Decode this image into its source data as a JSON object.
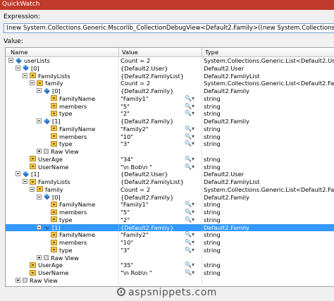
{
  "window": {
    "title": "QuickWatch"
  },
  "expression": {
    "label": "Expression:",
    "value": "(new System.Collections.Generic.Mscorlib_CollectionDebugView<Default2.Family>((new System.Collections.Generic.Mscorlib_CollectionDebugView<Default2"
  },
  "value_label": "Value:",
  "grid": {
    "columns": [
      "Name",
      "Value",
      "Type"
    ],
    "rows": [
      {
        "indent": 0,
        "toggle": "minus",
        "icon": "field-icon",
        "name": "userLists",
        "value": "Count = 2",
        "type": "System.Collections.Generic.List<Default2.User>",
        "mag": false
      },
      {
        "indent": 1,
        "toggle": "minus",
        "icon": "field-icon",
        "name": "[0]",
        "value": "{Default2.User}",
        "type": "Default2.User",
        "mag": false
      },
      {
        "indent": 2,
        "toggle": "minus",
        "icon": "property-icon",
        "name": "FamilyLists",
        "value": "{Default2.FamilyList}",
        "type": "Default2.FamilyList",
        "mag": false
      },
      {
        "indent": 3,
        "toggle": "minus",
        "icon": "property-icon",
        "name": "family",
        "value": "Count = 2",
        "type": "System.Collections.Generic.List<Default2.Family>",
        "mag": false
      },
      {
        "indent": 4,
        "toggle": "minus",
        "icon": "field-icon",
        "name": "[0]",
        "value": "{Default2.Family}",
        "type": "Default2.Family",
        "mag": false
      },
      {
        "indent": 5,
        "toggle": "none",
        "icon": "property-icon",
        "name": "FamilyName",
        "value": "\"Family1\"",
        "type": "string",
        "mag": true
      },
      {
        "indent": 5,
        "toggle": "none",
        "icon": "property-icon",
        "name": "members",
        "value": "\"5\"",
        "type": "string",
        "mag": true
      },
      {
        "indent": 5,
        "toggle": "none",
        "icon": "property-icon",
        "name": "type",
        "value": "\"2\"",
        "type": "string",
        "mag": true
      },
      {
        "indent": 4,
        "toggle": "minus",
        "icon": "field-icon",
        "name": "[1]",
        "value": "{Default2.Family}",
        "type": "Default2.Family",
        "mag": false
      },
      {
        "indent": 5,
        "toggle": "none",
        "icon": "property-icon",
        "name": "FamilyName",
        "value": "\"Family2\"",
        "type": "string",
        "mag": true
      },
      {
        "indent": 5,
        "toggle": "none",
        "icon": "property-icon",
        "name": "members",
        "value": "\"10\"",
        "type": "string",
        "mag": true
      },
      {
        "indent": 5,
        "toggle": "none",
        "icon": "property-icon",
        "name": "type",
        "value": "\"3\"",
        "type": "string",
        "mag": true
      },
      {
        "indent": 4,
        "toggle": "plus",
        "icon": "raw-view-icon",
        "name": "Raw View",
        "value": "",
        "type": "",
        "mag": false
      },
      {
        "indent": 2,
        "toggle": "none",
        "icon": "property-icon",
        "name": "UserAge",
        "value": "\"34\"",
        "type": "string",
        "mag": true
      },
      {
        "indent": 2,
        "toggle": "none",
        "icon": "property-icon",
        "name": "UserName",
        "value": "\"\\n      Bob\\n      \"",
        "type": "string",
        "mag": true
      },
      {
        "indent": 1,
        "toggle": "minus",
        "icon": "field-icon",
        "name": "[1]",
        "value": "{Default2.User}",
        "type": "Default2.User",
        "mag": false
      },
      {
        "indent": 2,
        "toggle": "minus",
        "icon": "property-icon",
        "name": "FamilyLists",
        "value": "{Default2.FamilyList}",
        "type": "Default2.FamilyList",
        "mag": false
      },
      {
        "indent": 3,
        "toggle": "minus",
        "icon": "property-icon",
        "name": "family",
        "value": "Count = 2",
        "type": "System.Collections.Generic.List<Default2.Family>",
        "mag": false
      },
      {
        "indent": 4,
        "toggle": "minus",
        "icon": "field-icon",
        "name": "[0]",
        "value": "{Default2.Family}",
        "type": "Default2.Family",
        "mag": false
      },
      {
        "indent": 5,
        "toggle": "none",
        "icon": "property-icon",
        "name": "FamilyName",
        "value": "\"Family1\"",
        "type": "string",
        "mag": true
      },
      {
        "indent": 5,
        "toggle": "none",
        "icon": "property-icon",
        "name": "members",
        "value": "\"5\"",
        "type": "string",
        "mag": true
      },
      {
        "indent": 5,
        "toggle": "none",
        "icon": "property-icon",
        "name": "type",
        "value": "\"2\"",
        "type": "string",
        "mag": true
      },
      {
        "indent": 4,
        "toggle": "minus",
        "icon": "field-icon",
        "name": "[1]",
        "value": "{Default2.Family}",
        "type": "Default2.Family",
        "mag": false,
        "selected": true
      },
      {
        "indent": 5,
        "toggle": "none",
        "icon": "property-icon",
        "name": "FamilyName",
        "value": "\"Family2\"",
        "type": "string",
        "mag": true
      },
      {
        "indent": 5,
        "toggle": "none",
        "icon": "property-icon",
        "name": "members",
        "value": "\"10\"",
        "type": "string",
        "mag": true
      },
      {
        "indent": 5,
        "toggle": "none",
        "icon": "property-icon",
        "name": "type",
        "value": "\"3\"",
        "type": "string",
        "mag": true
      },
      {
        "indent": 4,
        "toggle": "plus",
        "icon": "raw-view-icon",
        "name": "Raw View",
        "value": "",
        "type": "",
        "mag": false
      },
      {
        "indent": 2,
        "toggle": "none",
        "icon": "property-icon",
        "name": "UserAge",
        "value": "\"35\"",
        "type": "string",
        "mag": true
      },
      {
        "indent": 2,
        "toggle": "none",
        "icon": "property-icon",
        "name": "UserName",
        "value": "\"\\n      Rob\\n      \"",
        "type": "string",
        "mag": true
      },
      {
        "indent": 1,
        "toggle": "plus",
        "icon": "raw-view-icon",
        "name": "Raw View",
        "value": "",
        "type": "",
        "mag": false
      }
    ]
  },
  "watermark": "aspsnippets.com"
}
